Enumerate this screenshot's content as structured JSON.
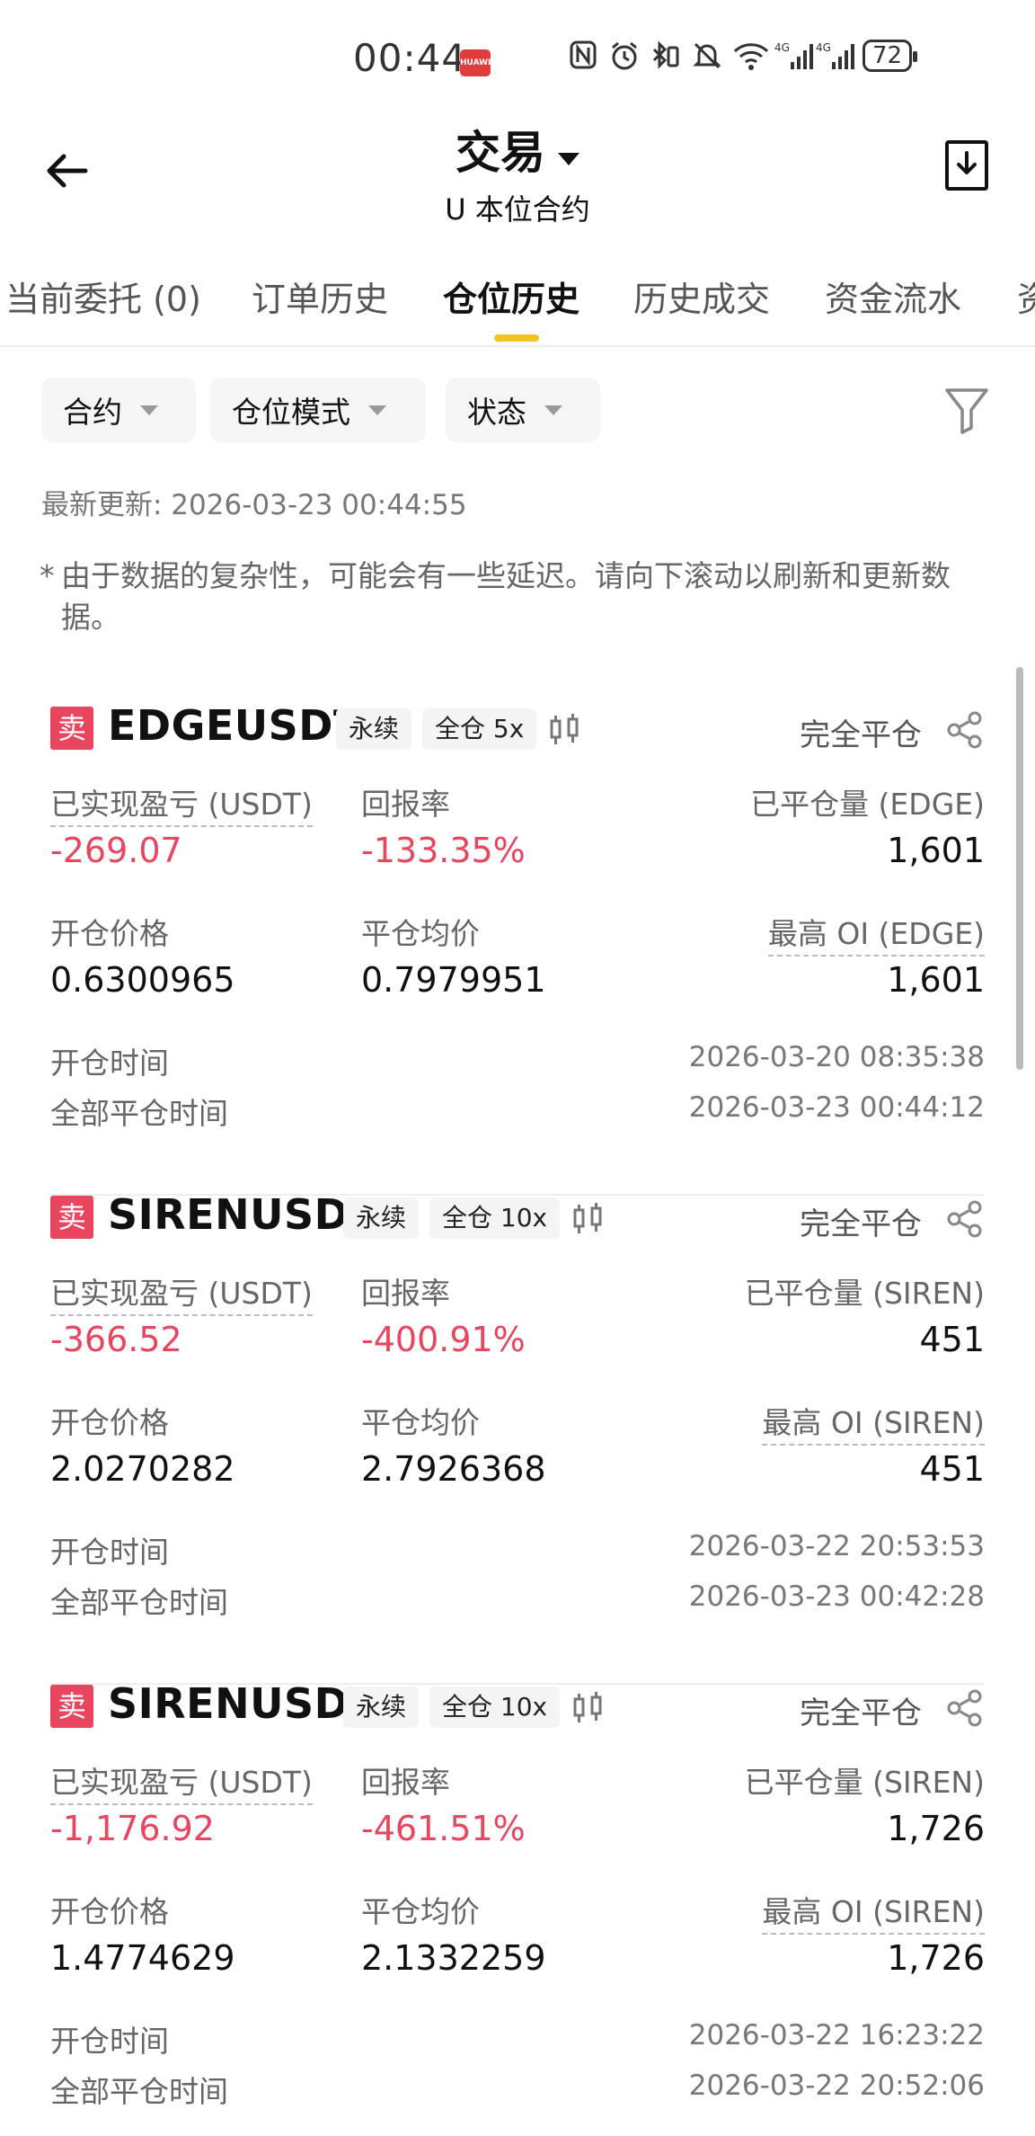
{
  "status_bar": {
    "time": "00:44",
    "badge": "HUAWEI",
    "battery": "72"
  },
  "header": {
    "title": "交易",
    "subtitle": "U 本位合约"
  },
  "tabs": [
    {
      "label": "当前委托 (0)"
    },
    {
      "label": "订单历史"
    },
    {
      "label": "仓位历史"
    },
    {
      "label": "历史成交"
    },
    {
      "label": "资金流水"
    },
    {
      "label": "资"
    }
  ],
  "filters": {
    "contract": "合约",
    "position_mode": "仓位模式",
    "status": "状态"
  },
  "updated_text": "最新更新: 2026-03-23 00:44:55",
  "note": {
    "star": "*",
    "text": "由于数据的复杂性，可能会有一些延迟。请向下滚动以刷新和更新数据。"
  },
  "labels": {
    "sell": "卖",
    "perpetual": "永续",
    "realized_pnl": "已实现盈亏 (USDT)",
    "roi": "回报率",
    "open_price": "开仓价格",
    "close_avg_price": "平仓均价",
    "open_time": "开仓时间",
    "full_close_time": "全部平仓时间",
    "status_closed": "完全平仓"
  },
  "positions": [
    {
      "symbol": "EDGEUSDT",
      "margin_mode": "全仓 5x",
      "realized_pnl": "-269.07",
      "roi": "-133.35%",
      "closed_qty_label": "已平仓量 (EDGE)",
      "closed_qty": "1,601",
      "open_price": "0.6300965",
      "close_avg_price": "0.7979951",
      "max_oi_label": "最高 OI (EDGE)",
      "max_oi": "1,601",
      "open_time": "2026-03-20 08:35:38",
      "full_close_time": "2026-03-23 00:44:12"
    },
    {
      "symbol": "SIRENUSDT",
      "margin_mode": "全仓 10x",
      "realized_pnl": "-366.52",
      "roi": "-400.91%",
      "closed_qty_label": "已平仓量 (SIREN)",
      "closed_qty": "451",
      "open_price": "2.0270282",
      "close_avg_price": "2.7926368",
      "max_oi_label": "最高 OI (SIREN)",
      "max_oi": "451",
      "open_time": "2026-03-22 20:53:53",
      "full_close_time": "2026-03-23 00:42:28"
    },
    {
      "symbol": "SIRENUSDT",
      "margin_mode": "全仓 10x",
      "realized_pnl": "-1,176.92",
      "roi": "-461.51%",
      "closed_qty_label": "已平仓量 (SIREN)",
      "closed_qty": "1,726",
      "open_price": "1.4774629",
      "close_avg_price": "2.1332259",
      "max_oi_label": "最高 OI (SIREN)",
      "max_oi": "1,726",
      "open_time": "2026-03-22 16:23:22",
      "full_close_time": "2026-03-22 20:52:06"
    }
  ]
}
